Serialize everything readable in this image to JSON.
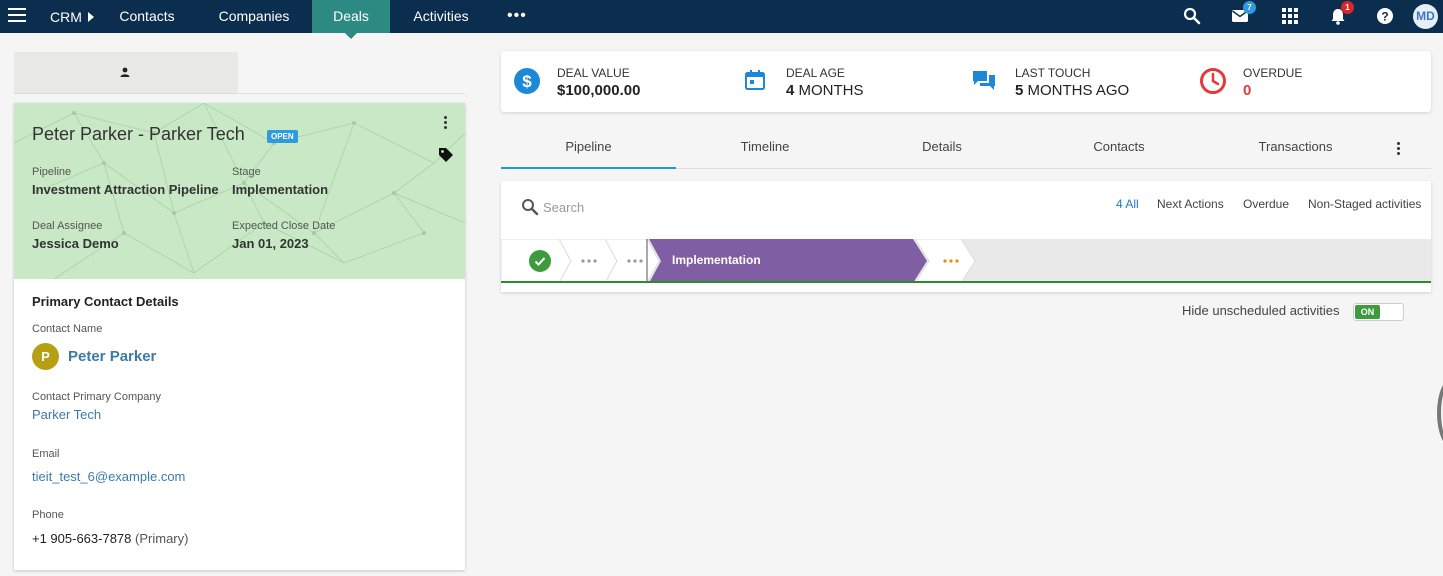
{
  "topbar": {
    "brand": "CRM",
    "nav": [
      "Contacts",
      "Companies",
      "Deals",
      "Activities"
    ],
    "active_nav": "Deals",
    "mail_badge": "7",
    "notif_badge": "1",
    "user_initials": "MD",
    "colors": {
      "bar": "#0c2e4e",
      "active": "#2c8a82"
    }
  },
  "deal": {
    "title": "Peter Parker - Parker Tech",
    "status": "OPEN",
    "pipeline_label": "Pipeline",
    "pipeline_value": "Investment Attraction Pipeline",
    "stage_label": "Stage",
    "stage_value": "Implementation",
    "assignee_label": "Deal Assignee",
    "assignee_value": "Jessica Demo",
    "close_label": "Expected Close Date",
    "close_value": "Jan 01, 2023"
  },
  "contact": {
    "section_title": "Primary Contact Details",
    "name_label": "Contact Name",
    "avatar_letter": "P",
    "name": "Peter Parker",
    "company_label": "Contact Primary Company",
    "company": "Parker Tech",
    "email_label": "Email",
    "email": "tieit_test_6@example.com",
    "phone_label": "Phone",
    "phone": "+1 905-663-7878",
    "phone_type": "(Primary)"
  },
  "stats": {
    "deal_value_label": "DEAL VALUE",
    "deal_value": "$100,000.00",
    "deal_age_label": "DEAL AGE",
    "deal_age_num": "4",
    "deal_age_unit": "MONTHS",
    "last_touch_label": "LAST TOUCH",
    "last_touch_num": "5",
    "last_touch_unit": "MONTHS AGO",
    "overdue_label": "OVERDUE",
    "overdue_value": "0"
  },
  "tabs": [
    "Pipeline",
    "Timeline",
    "Details",
    "Contacts",
    "Transactions"
  ],
  "activity": {
    "search_placeholder": "Search",
    "filters": [
      "4 All",
      "Next Actions",
      "Overdue",
      "Non-Staged activities"
    ],
    "current_stage": "Implementation",
    "hide_label": "Hide unscheduled activities",
    "toggle_state": "ON"
  }
}
